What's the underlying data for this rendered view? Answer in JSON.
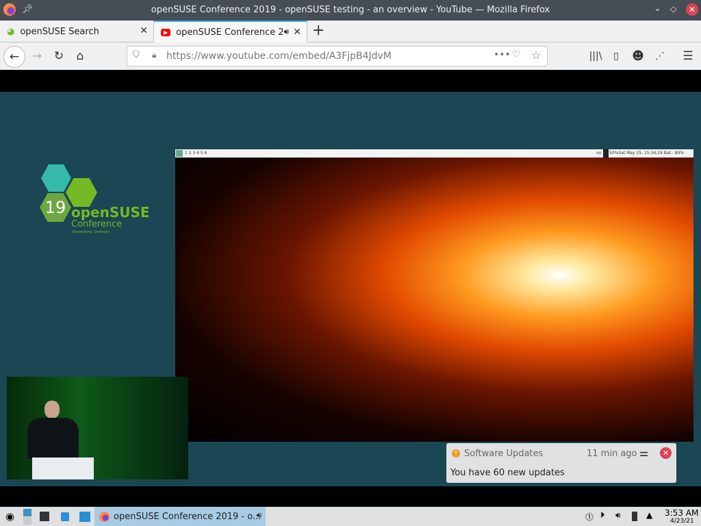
{
  "window": {
    "title": "openSUSE Conference 2019 - openSUSE testing - an overview - YouTube — Mozilla Firefox"
  },
  "tabs": [
    {
      "label": "openSUSE Search"
    },
    {
      "label": "openSUSE Conference 2"
    }
  ],
  "nav": {
    "url_host": "https://www.youtube.com",
    "url_path": "/embed/A3FjpB4JdvM"
  },
  "video": {
    "logo": {
      "number": "19",
      "brand": "openSUSE",
      "sub": "Conference",
      "location": "Nuremberg, Germany"
    },
    "desktop_bar": {
      "workspaces": "1 2 3 4 5 6",
      "status": "50%Sat May 25, 15:34:29 Bat.: 89%",
      "vol": "vo"
    }
  },
  "notification": {
    "app": "Software Updates",
    "time": "11 min ago",
    "body": "You have 60 new updates"
  },
  "taskbar": {
    "task_label": "openSUSE Conference 2019 - o...",
    "time": "3:53 AM",
    "date": "4/23/21"
  },
  "colors": {
    "accent": "#3daee9",
    "close": "#da4453",
    "frame": "#1b4653"
  }
}
